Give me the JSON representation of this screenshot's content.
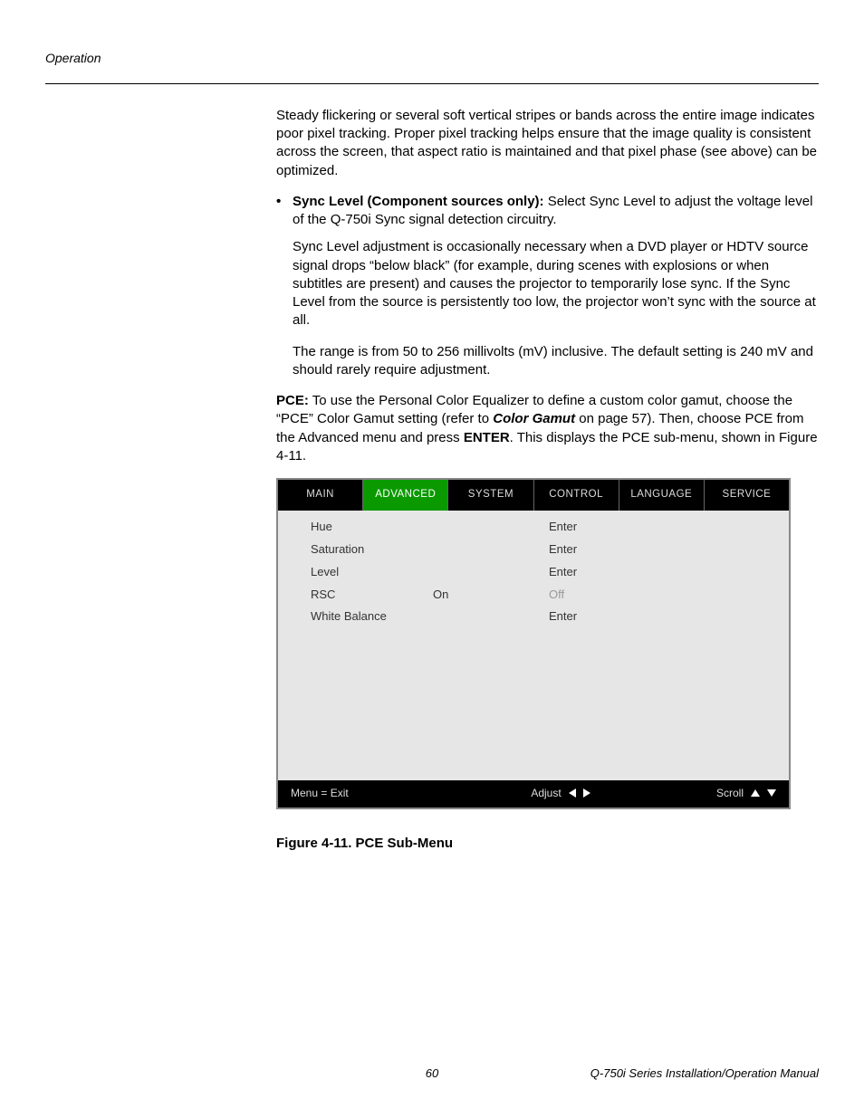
{
  "header": "Operation",
  "paras": {
    "p1": "Steady flickering or several soft vertical stripes or bands across the entire image indicates poor pixel tracking. Proper pixel tracking helps ensure that the image quality is consistent across the screen, that aspect ratio is maintained and that pixel phase (see above) can be optimized.",
    "bullet_bold": "Sync Level (Component sources only):",
    "bullet_rest": " Select Sync Level to adjust the voltage level of the Q-750i Sync signal detection circuitry.",
    "p2": "Sync Level adjustment is occasionally necessary when a DVD player or HDTV source signal drops “below black” (for example, during scenes with explosions or when subtitles are present) and causes the projector to temporarily lose sync. If the Sync Level from the source is persistently too low, the projector won’t sync with the source at all.",
    "p3": "The range is from 50 to 256 millivolts (mV) inclusive. The default setting is 240 mV and should rarely require adjustment.",
    "pce_bold": "PCE:",
    "pce_a": " To use the Personal Color Equalizer to define a custom color gamut, choose the “PCE” Color Gamut setting (refer to ",
    "pce_italic": "Color Gamut",
    "pce_b": " on page 57). Then, choose PCE from the Advanced menu and press ",
    "pce_enter": "ENTER",
    "pce_c": ". This displays the PCE sub-menu, shown in Figure 4-11."
  },
  "menu": {
    "tabs": [
      "MAIN",
      "ADVANCED",
      "SYSTEM",
      "CONTROL",
      "LANGUAGE",
      "SERVICE"
    ],
    "active_index": 1,
    "rows": [
      {
        "label": "Hue",
        "v1": "",
        "v2": "Enter",
        "dim_v2": false
      },
      {
        "label": "Saturation",
        "v1": "",
        "v2": "Enter",
        "dim_v2": false
      },
      {
        "label": "Level",
        "v1": "",
        "v2": "Enter",
        "dim_v2": false
      },
      {
        "label": "RSC",
        "v1": "On",
        "v2": "Off",
        "dim_v2": true
      },
      {
        "label": "White Balance",
        "v1": "",
        "v2": "Enter",
        "dim_v2": false
      }
    ],
    "footer": {
      "exit": "Menu = Exit",
      "adjust": "Adjust",
      "scroll": "Scroll"
    }
  },
  "caption": "Figure 4-11. PCE Sub-Menu",
  "footer": {
    "page": "60",
    "doc": "Q-750i Series Installation/Operation Manual"
  }
}
